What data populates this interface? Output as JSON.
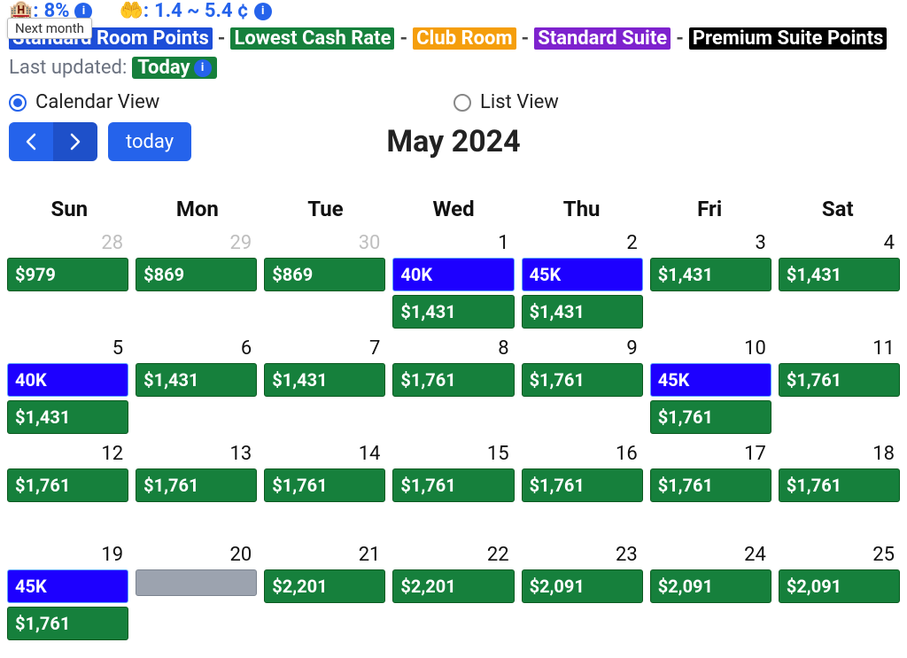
{
  "tooltip": "Next month",
  "stats": {
    "occupancy": "8%",
    "range": "1.4 ~ 5.4 ¢"
  },
  "legend": {
    "standard_points": "Standard Room Points",
    "lowest_cash": "Lowest Cash Rate",
    "club_room": "Club Room",
    "standard_suite": "Standard Suite",
    "premium_suite": "Premium Suite Points",
    "sep": "-"
  },
  "updated": {
    "label": "Last updated:",
    "value": "Today"
  },
  "views": {
    "calendar": "Calendar View",
    "list": "List View"
  },
  "nav": {
    "today": "today",
    "title": "May 2024"
  },
  "daysOfWeek": [
    "Sun",
    "Mon",
    "Tue",
    "Wed",
    "Thu",
    "Fri",
    "Sat"
  ],
  "weeks": [
    [
      {
        "n": "28",
        "other": true,
        "ev": [
          {
            "t": "green",
            "v": "$979"
          }
        ]
      },
      {
        "n": "29",
        "other": true,
        "ev": [
          {
            "t": "green",
            "v": "$869"
          }
        ]
      },
      {
        "n": "30",
        "other": true,
        "ev": [
          {
            "t": "green",
            "v": "$869"
          }
        ]
      },
      {
        "n": "1",
        "ev": [
          {
            "t": "blue",
            "v": "40K"
          },
          {
            "t": "green",
            "v": "$1,431"
          }
        ]
      },
      {
        "n": "2",
        "ev": [
          {
            "t": "blue",
            "v": "45K"
          },
          {
            "t": "green",
            "v": "$1,431"
          }
        ]
      },
      {
        "n": "3",
        "ev": [
          {
            "t": "green",
            "v": "$1,431"
          }
        ]
      },
      {
        "n": "4",
        "ev": [
          {
            "t": "green",
            "v": "$1,431"
          }
        ]
      }
    ],
    [
      {
        "n": "5",
        "ev": [
          {
            "t": "blue",
            "v": "40K"
          },
          {
            "t": "green",
            "v": "$1,431"
          }
        ]
      },
      {
        "n": "6",
        "ev": [
          {
            "t": "green",
            "v": "$1,431"
          }
        ]
      },
      {
        "n": "7",
        "ev": [
          {
            "t": "green",
            "v": "$1,431"
          }
        ]
      },
      {
        "n": "8",
        "ev": [
          {
            "t": "green",
            "v": "$1,761"
          }
        ]
      },
      {
        "n": "9",
        "ev": [
          {
            "t": "green",
            "v": "$1,761"
          }
        ]
      },
      {
        "n": "10",
        "ev": [
          {
            "t": "blue",
            "v": "45K"
          },
          {
            "t": "green",
            "v": "$1,761"
          }
        ]
      },
      {
        "n": "11",
        "ev": [
          {
            "t": "green",
            "v": "$1,761"
          }
        ]
      }
    ],
    [
      {
        "n": "12",
        "ev": [
          {
            "t": "green",
            "v": "$1,761"
          }
        ]
      },
      {
        "n": "13",
        "ev": [
          {
            "t": "green",
            "v": "$1,761"
          }
        ]
      },
      {
        "n": "14",
        "ev": [
          {
            "t": "green",
            "v": "$1,761"
          }
        ]
      },
      {
        "n": "15",
        "ev": [
          {
            "t": "green",
            "v": "$1,761"
          }
        ]
      },
      {
        "n": "16",
        "ev": [
          {
            "t": "green",
            "v": "$1,761"
          }
        ]
      },
      {
        "n": "17",
        "ev": [
          {
            "t": "green",
            "v": "$1,761"
          }
        ]
      },
      {
        "n": "18",
        "ev": [
          {
            "t": "green",
            "v": "$1,761"
          }
        ]
      }
    ],
    [
      {
        "n": "19",
        "ev": [
          {
            "t": "blue",
            "v": "45K"
          },
          {
            "t": "green",
            "v": "$1,761"
          }
        ]
      },
      {
        "n": "20",
        "ev": [
          {
            "t": "grey",
            "v": ""
          }
        ]
      },
      {
        "n": "21",
        "ev": [
          {
            "t": "green",
            "v": "$2,201"
          }
        ]
      },
      {
        "n": "22",
        "ev": [
          {
            "t": "green",
            "v": "$2,201"
          }
        ]
      },
      {
        "n": "23",
        "ev": [
          {
            "t": "green",
            "v": "$2,091"
          }
        ]
      },
      {
        "n": "24",
        "ev": [
          {
            "t": "green",
            "v": "$2,091"
          }
        ]
      },
      {
        "n": "25",
        "ev": [
          {
            "t": "green",
            "v": "$2,091"
          }
        ]
      }
    ]
  ]
}
